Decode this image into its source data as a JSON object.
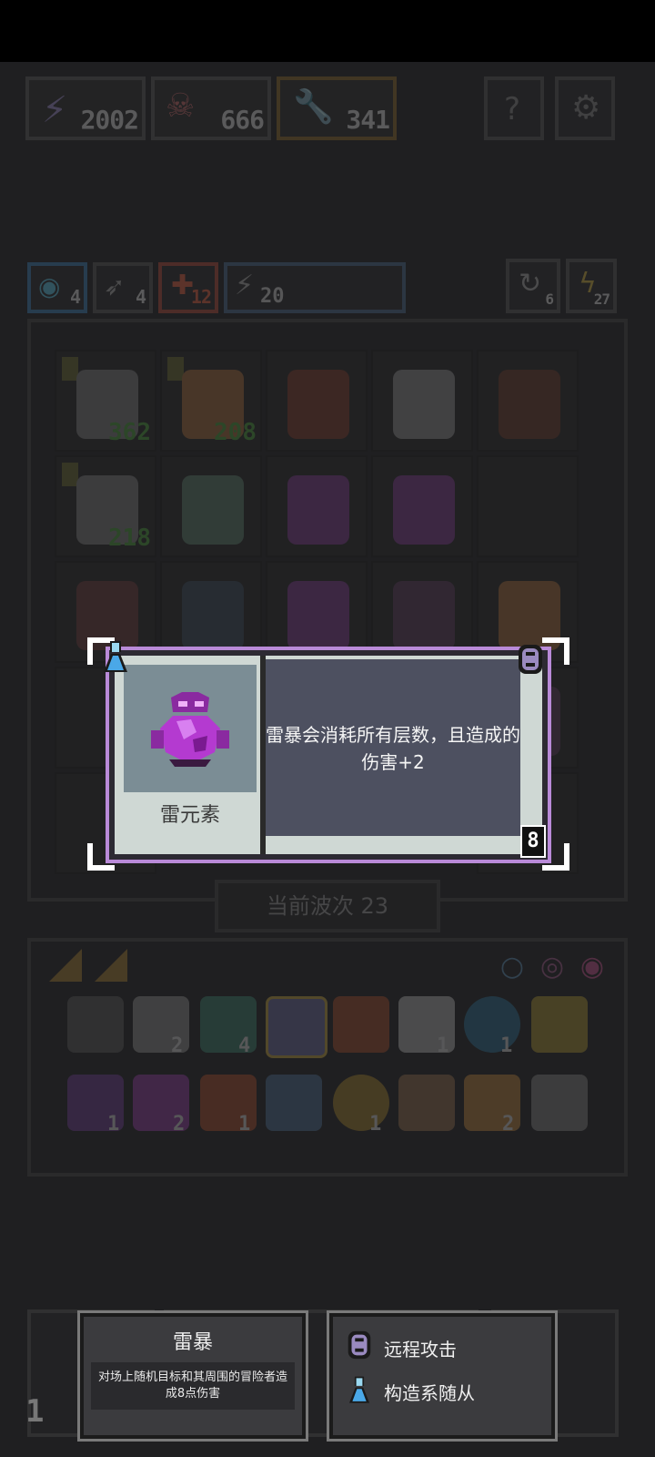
{
  "header": {
    "resources": [
      {
        "icon": "lightning-icon",
        "value": "2002"
      },
      {
        "icon": "skull-pile-icon",
        "value": "666"
      },
      {
        "icon": "wrench-icon",
        "value": "341"
      }
    ]
  },
  "buffs": [
    {
      "icon": "shield-icon",
      "value": "4"
    },
    {
      "icon": "bow-icon",
      "value": "4"
    },
    {
      "icon": "attack-icon",
      "value": "12"
    },
    {
      "icon": "lightning-icon",
      "value": "20"
    }
  ],
  "side_counters": [
    {
      "icon": "refresh-icon",
      "value": "6"
    },
    {
      "icon": "bolt-icon",
      "value": "27"
    }
  ],
  "grid_hp": [
    "362",
    "208",
    "218"
  ],
  "wave": {
    "label": "当前波次 23"
  },
  "popup": {
    "name": "雷元素",
    "description": "雷暴会消耗所有层数，且造成的伤害+2",
    "cost": "8",
    "accent": "#b98ad8"
  },
  "skill_tip": {
    "title": "雷暴",
    "body": "对场上随机目标和其周围的冒险者造成8点伤害"
  },
  "traits_tip": {
    "items": [
      {
        "icon": "ranged-bow-icon",
        "label": "远程攻击"
      },
      {
        "icon": "flask-icon",
        "label": "构造系随从"
      }
    ]
  },
  "inventory_counts": [
    "2",
    "4",
    "1",
    "1",
    "1",
    "2",
    "1",
    "1",
    "2"
  ],
  "left_corner_number": "1"
}
